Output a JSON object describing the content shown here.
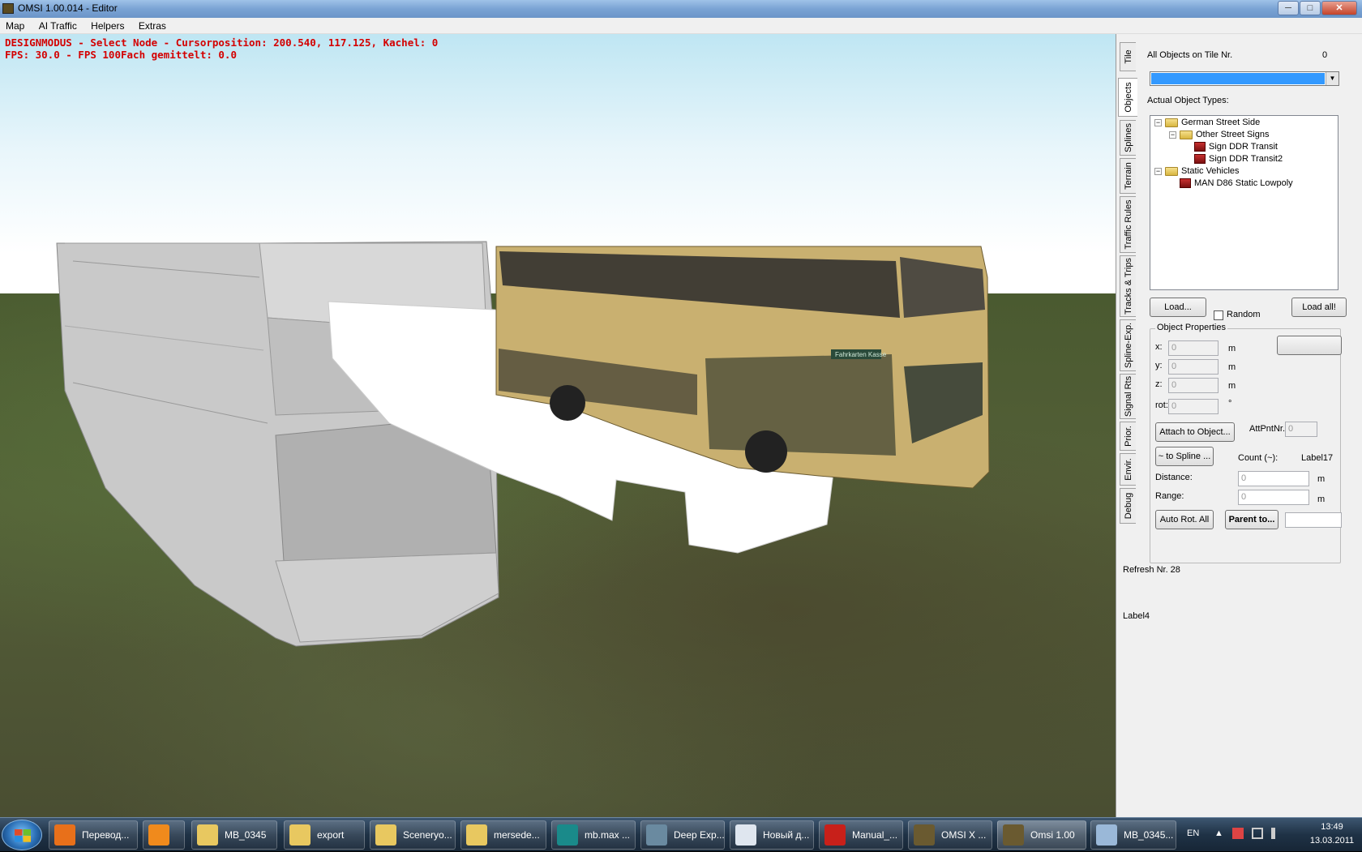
{
  "window": {
    "title": "OMSI 1.00.014 - Editor",
    "buttons": {
      "minimize": "─",
      "maximize": "□",
      "close": "✕"
    }
  },
  "menu": [
    "Map",
    "AI Traffic",
    "Helpers",
    "Extras"
  ],
  "viewport": {
    "status_line1": "DESIGNMODUS - Select Node - Cursorposition: 200.540, 117.125, Kachel: 0",
    "status_line2": "FPS: 30.0 - FPS 100Fach gemittelt: 0.0",
    "bus_sign": "Fahrkarten Kasse"
  },
  "panel": {
    "tabs": [
      "Tile",
      "Objects",
      "Splines",
      "Terrain",
      "Traffic Rules",
      "Tracks & Trips",
      "Spline-Exp.",
      "Signal Rts",
      "Prior.",
      "Envir.",
      "Debug"
    ],
    "all_objects_label": "All Objects on Tile Nr.",
    "tile_nr": "0",
    "actual_types_label": "Actual Object Types:",
    "tree": [
      {
        "label": "German Street Side",
        "level": 0,
        "type": "folder",
        "expander": "−"
      },
      {
        "label": "Other Street Signs",
        "level": 1,
        "type": "folder",
        "expander": "−"
      },
      {
        "label": "Sign DDR Transit",
        "level": 2,
        "type": "object"
      },
      {
        "label": "Sign DDR Transit2",
        "level": 2,
        "type": "object"
      },
      {
        "label": "Static Vehicles",
        "level": 0,
        "type": "folder",
        "expander": "−"
      },
      {
        "label": "MAN D86 Static Lowpoly",
        "level": 1,
        "type": "object"
      }
    ],
    "load_button": "Load...",
    "random_label": "Random",
    "load_all_button": "Load all!",
    "object_properties": "Object Properties",
    "x_label": "x:",
    "y_label": "y:",
    "z_label": "z:",
    "rot_label": "rot:",
    "x_value": "0",
    "y_value": "0",
    "z_value": "0",
    "rot_value": "0",
    "unit_m": "m",
    "unit_deg": "°",
    "attach_button": "Attach to Object...",
    "attpnt_label": "AttPntNr.:",
    "attpnt_value": "0",
    "to_spline_button": "~ to Spline ...",
    "count_label": "Count (~):",
    "label17": "Label17",
    "distance_label": "Distance:",
    "distance_value": "0",
    "range_label": "Range:",
    "range_value": "0",
    "autorot_button": "Auto Rot. All",
    "parent_button": "Parent to...",
    "refresh": "Refresh Nr. 28",
    "label4": "Label4"
  },
  "taskbar": {
    "items": [
      {
        "label": "Перевод...",
        "icon": "firefox-icon",
        "color": "#e8701a"
      },
      {
        "label": "",
        "icon": "media-player-icon",
        "color": "#f08a1c"
      },
      {
        "label": "MB_0345",
        "icon": "folder-icon",
        "color": "#e8c860"
      },
      {
        "label": "export",
        "icon": "folder-icon",
        "color": "#e8c860"
      },
      {
        "label": "Sceneryo...",
        "icon": "folder-icon",
        "color": "#e8c860"
      },
      {
        "label": "mersede...",
        "icon": "folder-icon",
        "color": "#e8c860"
      },
      {
        "label": "mb.max ...",
        "icon": "3dsmax-icon",
        "color": "#1a8a8a"
      },
      {
        "label": "Deep Exp...",
        "icon": "deep-exploration-icon",
        "color": "#6a8aa0"
      },
      {
        "label": "Новый д...",
        "icon": "document-icon",
        "color": "#dfe6ef"
      },
      {
        "label": "Manual_...",
        "icon": "pdf-icon",
        "color": "#c8201a"
      },
      {
        "label": "OMSI X ...",
        "icon": "omsi-icon",
        "color": "#6a5a30"
      },
      {
        "label": "Omsi 1.00",
        "icon": "omsi-icon",
        "color": "#6a5a30"
      },
      {
        "label": "MB_0345...",
        "icon": "image-viewer-icon",
        "color": "#9ab8d8"
      }
    ],
    "language": "EN",
    "time": "13:49",
    "date": "13.03.2011"
  }
}
